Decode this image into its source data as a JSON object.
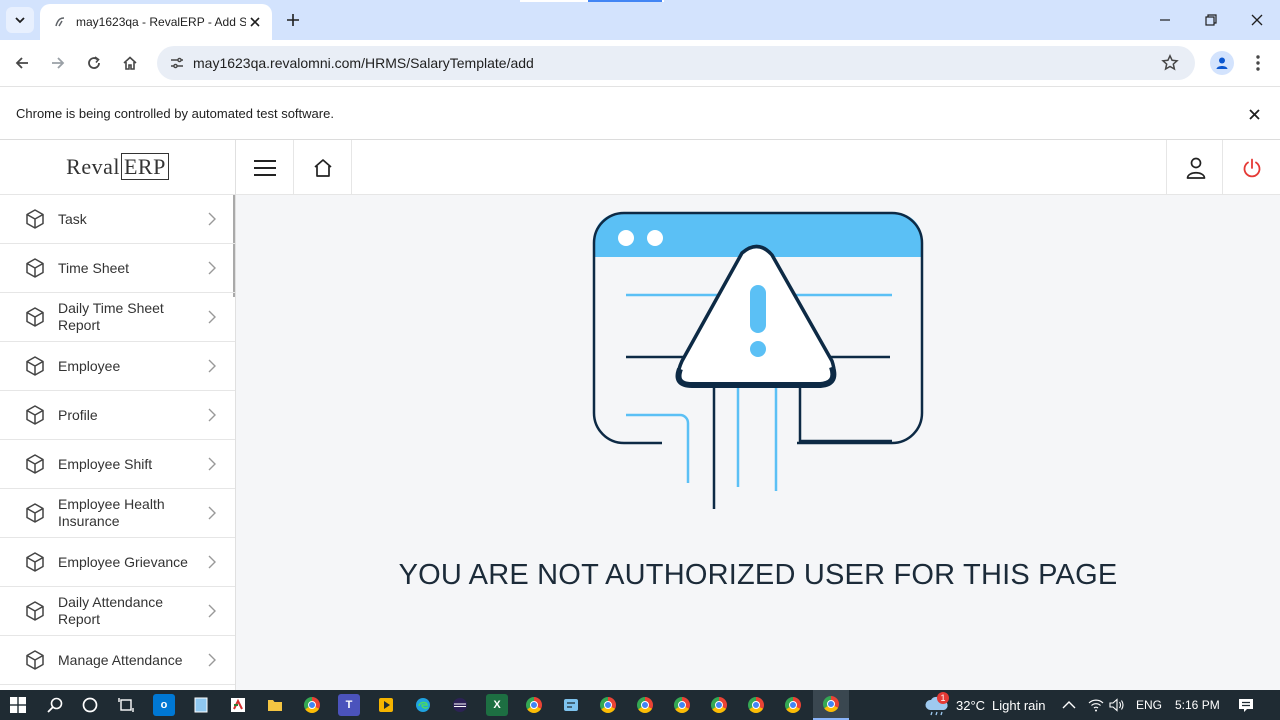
{
  "browser": {
    "tab_title": "may1623qa - RevalERP - Add S",
    "url": "may1623qa.revalomni.com/HRMS/SalaryTemplate/add",
    "infobar_message": "Chrome is being controlled by automated test software."
  },
  "sidebar": {
    "logo_text_a": "Reval",
    "logo_text_b": "ERP",
    "items": [
      {
        "label": "Task"
      },
      {
        "label": "Time Sheet"
      },
      {
        "label": "Daily Time Sheet Report"
      },
      {
        "label": "Employee"
      },
      {
        "label": "Profile"
      },
      {
        "label": "Employee Shift"
      },
      {
        "label": "Employee Health Insurance"
      },
      {
        "label": "Employee Grievance"
      },
      {
        "label": "Daily Attendance Report"
      },
      {
        "label": "Manage Attendance"
      }
    ]
  },
  "main": {
    "error_message": "YOU ARE NOT AUTHORIZED USER FOR THIS PAGE"
  },
  "taskbar": {
    "temperature": "32°C",
    "weather": "Light rain",
    "weather_badge": "1",
    "language": "ENG",
    "time": "5:16 PM"
  },
  "colors": {
    "illustration_accent": "#5bc0f5",
    "illustration_outline": "#0d2a45",
    "power_icon": "#e53935"
  }
}
